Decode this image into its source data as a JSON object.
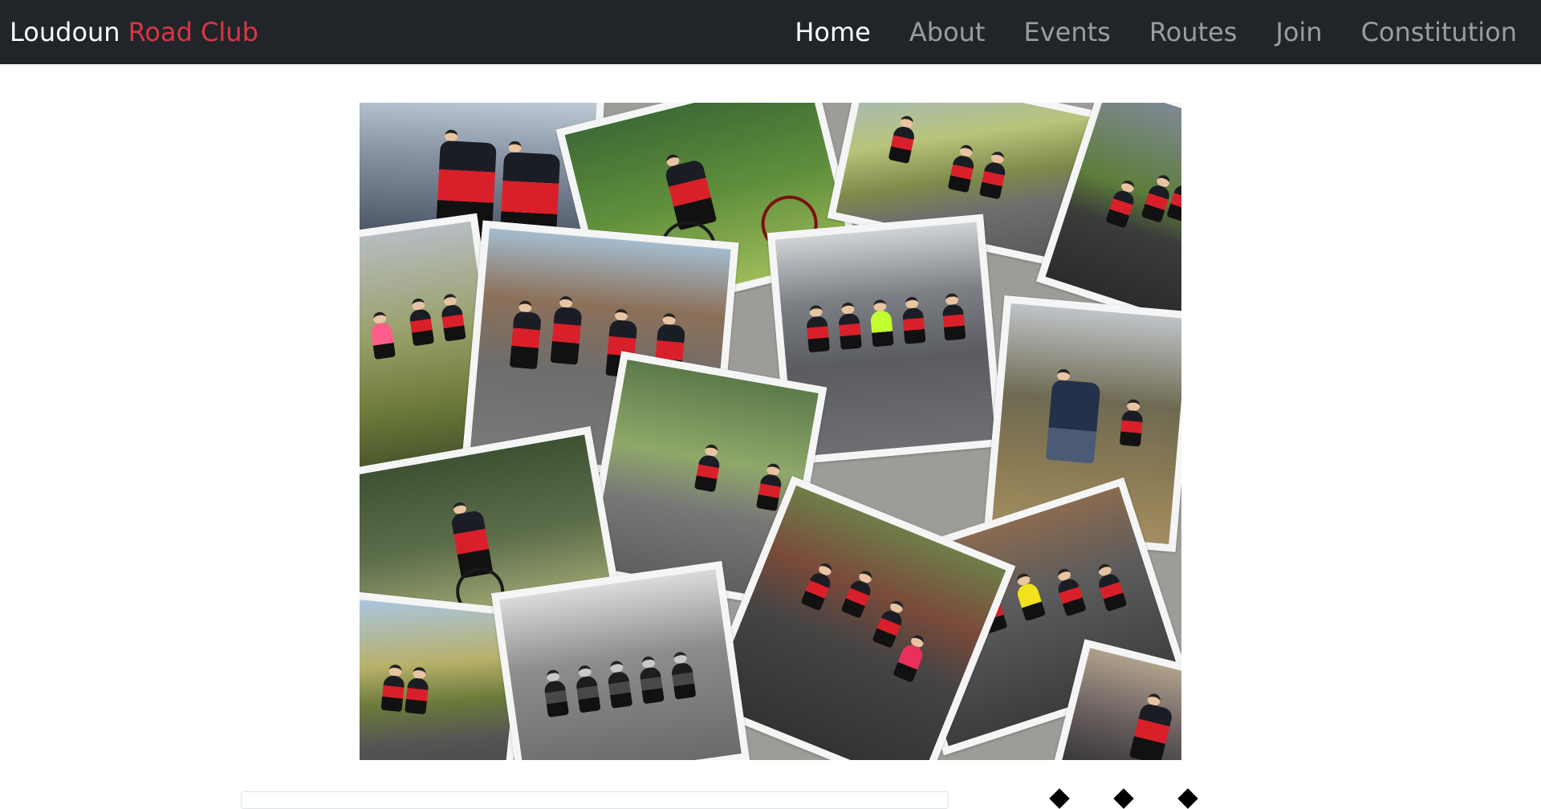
{
  "brand": {
    "primary": "Loudoun",
    "accent": "Road Club",
    "accent_color": "#dc3545"
  },
  "nav": {
    "items": [
      {
        "label": "Home",
        "active": true
      },
      {
        "label": "About",
        "active": false
      },
      {
        "label": "Events",
        "active": false
      },
      {
        "label": "Routes",
        "active": false
      },
      {
        "label": "Join",
        "active": false
      },
      {
        "label": "Constitution",
        "active": false
      }
    ]
  },
  "hero": {
    "image": "cycling-photo-collage",
    "background_color": "#9e9c99"
  },
  "social": {
    "icons": [
      "social-icon",
      "social-icon",
      "social-icon"
    ]
  }
}
